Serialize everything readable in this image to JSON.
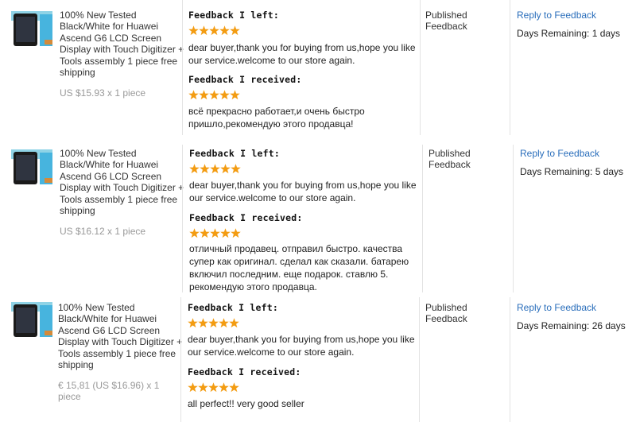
{
  "orders": [
    {
      "product_title": "100% New Tested Black/White for Huawei Ascend G6 LCD Screen Display with Touch Digitizer + Tools assembly 1 piece free shipping",
      "price": "US $15.93 x 1 piece",
      "feedback_left_label": "Feedback I left:",
      "feedback_left_stars": 5,
      "feedback_left_text": "dear buyer,thank you for buying from us,hope you like our service.welcome to our store again.",
      "feedback_received_label": "Feedback I received:",
      "feedback_received_stars": 5,
      "feedback_received_text": "всё прекрасно работает,и очень быстро пришло,рекомендую этого продавца!",
      "status": "Published Feedback",
      "reply_link": "Reply to Feedback",
      "days_remaining": "Days Remaining: 1 days"
    },
    {
      "product_title": "100% New Tested Black/White for Huawei Ascend G6 LCD Screen Display with Touch Digitizer + Tools assembly 1 piece free shipping",
      "price": "US $16.12 x 1 piece",
      "feedback_left_label": "Feedback I left:",
      "feedback_left_stars": 5,
      "feedback_left_text": "dear buyer,thank you for buying from us,hope you like our service.welcome to our store again.",
      "feedback_received_label": "Feedback I received:",
      "feedback_received_stars": 5,
      "feedback_received_text": "отличный продавец. отправил быстро. качества супер как оригинал. сделал как сказали. батарею включил последним. еще подарок. ставлю 5. рекомендую этого продавца.",
      "status": "Published Feedback",
      "reply_link": "Reply to Feedback",
      "days_remaining": "Days Remaining: 5 days"
    },
    {
      "product_title": "100% New Tested Black/White for Huawei Ascend G6 LCD Screen Display with Touch Digitizer + Tools assembly 1 piece free shipping",
      "price": "€ 15,81 (US $16.96) x 1 piece",
      "feedback_left_label": "Feedback I left:",
      "feedback_left_stars": 5,
      "feedback_left_text": "dear buyer,thank you for buying from us,hope you like our service.welcome to our store again.",
      "feedback_received_label": "Feedback I received:",
      "feedback_received_stars": 5,
      "feedback_received_text": "all perfect!! very good seller",
      "status": "Published Feedback",
      "reply_link": "Reply to Feedback",
      "days_remaining": "Days Remaining: 26 days"
    }
  ],
  "colors": {
    "star": "#f39c12",
    "link": "#2a6ebb",
    "muted": "#999999"
  }
}
